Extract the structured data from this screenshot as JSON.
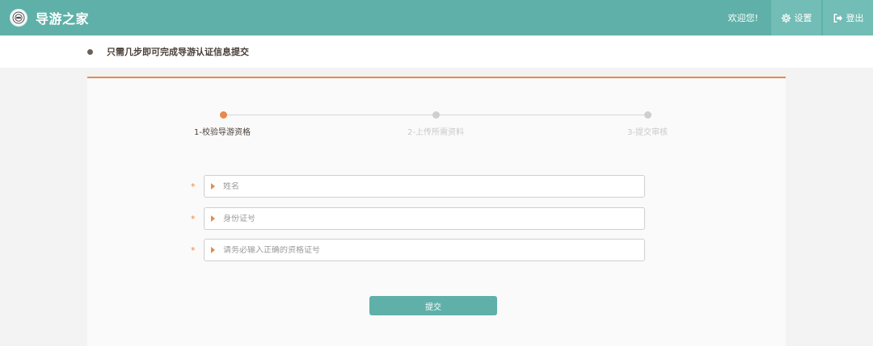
{
  "header": {
    "brand": "导游之家",
    "welcome": "欢迎您!",
    "settings_label": "设置",
    "logout_label": "登出",
    "bg_color": "#5fb0a8"
  },
  "notice": {
    "text": "只需几步即可完成导游认证信息提交"
  },
  "steps": [
    {
      "label": "1-校验导游资格",
      "active": true
    },
    {
      "label": "2-上传所需资料",
      "active": false
    },
    {
      "label": "3-提交审核",
      "active": false
    }
  ],
  "form": {
    "required_mark": "*",
    "fields": [
      {
        "placeholder": "姓名",
        "value": ""
      },
      {
        "placeholder": "身份证号",
        "value": ""
      },
      {
        "placeholder": "请务必输入正确的资格证号",
        "value": ""
      }
    ],
    "submit_label": "提交"
  },
  "colors": {
    "accent": "#e8894a",
    "primary": "#5fb0a8"
  },
  "icons": {
    "logo": "guide-logo-icon",
    "settings": "gear-icon",
    "logout": "logout-icon"
  }
}
